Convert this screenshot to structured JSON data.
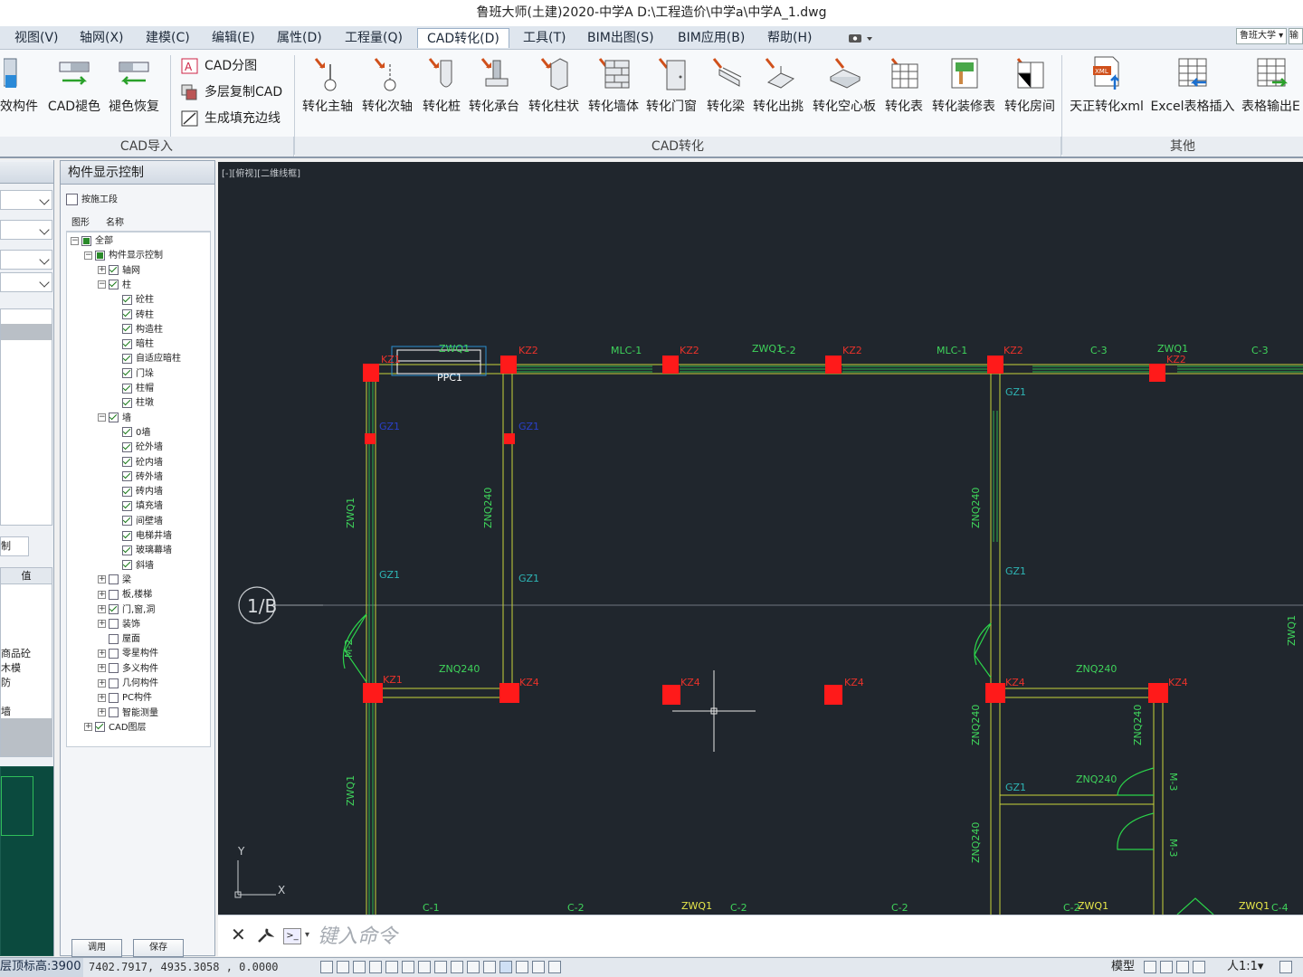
{
  "window": {
    "title": "鲁班大师(土建)2020-中学A    D:\\工程造价\\中学a\\中学A_1.dwg"
  },
  "menu": {
    "items": [
      {
        "label": "视图(V)"
      },
      {
        "label": "轴网(X)"
      },
      {
        "label": "建模(C)"
      },
      {
        "label": "编辑(E)"
      },
      {
        "label": "属性(D)"
      },
      {
        "label": "工程量(Q)"
      },
      {
        "label": "CAD转化(D)"
      },
      {
        "label": "工具(T)"
      },
      {
        "label": "BIM出图(S)"
      },
      {
        "label": "BIM应用(B)"
      },
      {
        "label": "帮助(H)"
      }
    ],
    "active_index": 6,
    "user_badge": "鲁班大学 ▾",
    "extra_badge": "输入"
  },
  "ribbon": {
    "import_group": {
      "label": "CAD导入",
      "buttons": [
        {
          "label": "效构件"
        },
        {
          "label": "CAD褪色"
        },
        {
          "label": "褪色恢复"
        }
      ],
      "small_buttons": [
        {
          "label": "CAD分图"
        },
        {
          "label": "多层复制CAD"
        },
        {
          "label": "生成填充边线"
        }
      ]
    },
    "convert_group": {
      "label": "CAD转化",
      "buttons": [
        {
          "label": "转化主轴"
        },
        {
          "label": "转化次轴"
        },
        {
          "label": "转化桩"
        },
        {
          "label": "转化承台"
        },
        {
          "label": "转化柱状"
        },
        {
          "label": "转化墙体"
        },
        {
          "label": "转化门窗"
        },
        {
          "label": "转化梁"
        },
        {
          "label": "转化出挑"
        },
        {
          "label": "转化空心板"
        },
        {
          "label": "转化表"
        },
        {
          "label": "转化装修表"
        },
        {
          "label": "转化房间"
        }
      ]
    },
    "other_group": {
      "label": "其他",
      "buttons": [
        {
          "label": "天正转化xml"
        },
        {
          "label": "Excel表格插入"
        },
        {
          "label": "表格输出E"
        }
      ]
    }
  },
  "left_panel": {
    "texts": [
      "制",
      "值",
      "商品砼",
      "木模",
      "防",
      "墙"
    ]
  },
  "component_panel": {
    "title": "构件显示控制",
    "by_stage_label": "按施工段",
    "columns": {
      "shape": "图形",
      "name": "名称"
    },
    "tree": [
      {
        "label": "全部",
        "level": 0,
        "expanded": true,
        "state": "part"
      },
      {
        "label": "构件显示控制",
        "level": 1,
        "expanded": true,
        "state": "part"
      },
      {
        "label": "轴网",
        "level": 2,
        "expanded": false,
        "state": "on"
      },
      {
        "label": "柱",
        "level": 2,
        "expanded": true,
        "state": "on"
      },
      {
        "label": "砼柱",
        "level": 3,
        "state": "on"
      },
      {
        "label": "砖柱",
        "level": 3,
        "state": "on"
      },
      {
        "label": "构造柱",
        "level": 3,
        "state": "on"
      },
      {
        "label": "暗柱",
        "level": 3,
        "state": "on"
      },
      {
        "label": "自适应暗柱",
        "level": 3,
        "state": "on"
      },
      {
        "label": "门垛",
        "level": 3,
        "state": "on"
      },
      {
        "label": "柱帽",
        "level": 3,
        "state": "on"
      },
      {
        "label": "柱墩",
        "level": 3,
        "state": "on"
      },
      {
        "label": "墙",
        "level": 2,
        "expanded": true,
        "state": "on"
      },
      {
        "label": "0墙",
        "level": 3,
        "state": "on"
      },
      {
        "label": "砼外墙",
        "level": 3,
        "state": "on"
      },
      {
        "label": "砼内墙",
        "level": 3,
        "state": "on"
      },
      {
        "label": "砖外墙",
        "level": 3,
        "state": "on"
      },
      {
        "label": "砖内墙",
        "level": 3,
        "state": "on"
      },
      {
        "label": "填充墙",
        "level": 3,
        "state": "on"
      },
      {
        "label": "间壁墙",
        "level": 3,
        "state": "on"
      },
      {
        "label": "电梯井墙",
        "level": 3,
        "state": "on"
      },
      {
        "label": "玻璃幕墙",
        "level": 3,
        "state": "on"
      },
      {
        "label": "斜墙",
        "level": 3,
        "state": "on"
      },
      {
        "label": "梁",
        "level": 2,
        "expanded": false,
        "state": "off"
      },
      {
        "label": "板,楼梯",
        "level": 2,
        "expanded": false,
        "state": "off"
      },
      {
        "label": "门,窗,洞",
        "level": 2,
        "expanded": false,
        "state": "on"
      },
      {
        "label": "装饰",
        "level": 2,
        "expanded": false,
        "state": "off"
      },
      {
        "label": "屋面",
        "level": 2,
        "leaf": true,
        "state": "off"
      },
      {
        "label": "零星构件",
        "level": 2,
        "expanded": false,
        "state": "off"
      },
      {
        "label": "多义构件",
        "level": 2,
        "expanded": false,
        "state": "off"
      },
      {
        "label": "几何构件",
        "level": 2,
        "expanded": false,
        "state": "off"
      },
      {
        "label": "PC构件",
        "level": 2,
        "expanded": false,
        "state": "off"
      },
      {
        "label": "智能测量",
        "level": 2,
        "expanded": false,
        "state": "off"
      },
      {
        "label": "CAD图层",
        "level": 1,
        "expanded": false,
        "state": "on"
      }
    ],
    "apply_button": "调用",
    "save_button": "保存"
  },
  "canvas": {
    "view_label": "[-][俯视][二维线框]",
    "axis_bubble": "1/B",
    "ucs": {
      "x": "X",
      "y": "Y"
    },
    "labels": {
      "red": [
        "KZ1",
        "KZ2",
        "KZ2",
        "KZ2",
        "KZ2",
        "KZ2",
        "KZ1",
        "KZ4",
        "KZ4",
        "KZ4",
        "KZ4",
        "KZ4",
        "KZ2"
      ],
      "green_top": [
        "ZWQ1",
        "MLC-1",
        "ZWQ1",
        "C-2",
        "MLC-1",
        "C-3",
        "ZWQ1",
        "C-3"
      ],
      "green_mid": [
        "ZNQ240",
        "ZNQ240",
        "ZNQ240",
        "ZNQ240",
        "ZNQ240",
        "ZNQ240",
        "ZNQ240",
        "ZNQ240",
        "ZWQ1",
        "ZWQ1",
        "ZWQ1",
        "M-3",
        "M-3",
        "M-2"
      ],
      "green_bottom": [
        "C-1",
        "C-2",
        "ZWQ1",
        "C-2",
        "C-2",
        "C-2",
        "ZWQ1",
        "ZWQ1",
        "C-4"
      ],
      "cyan": [
        "GZ1",
        "GZ1",
        "GZ1",
        "GZ1",
        "GZ1",
        "GZ1",
        "GZ1"
      ],
      "white": [
        "PPC1"
      ]
    }
  },
  "command": {
    "placeholder": "键入命令"
  },
  "status": {
    "floor_elev": "层顶标高:3900",
    "coords": "7402.7917,  4935.3058 ,  0.0000",
    "model": "模型",
    "scale": "人1:1▾"
  }
}
